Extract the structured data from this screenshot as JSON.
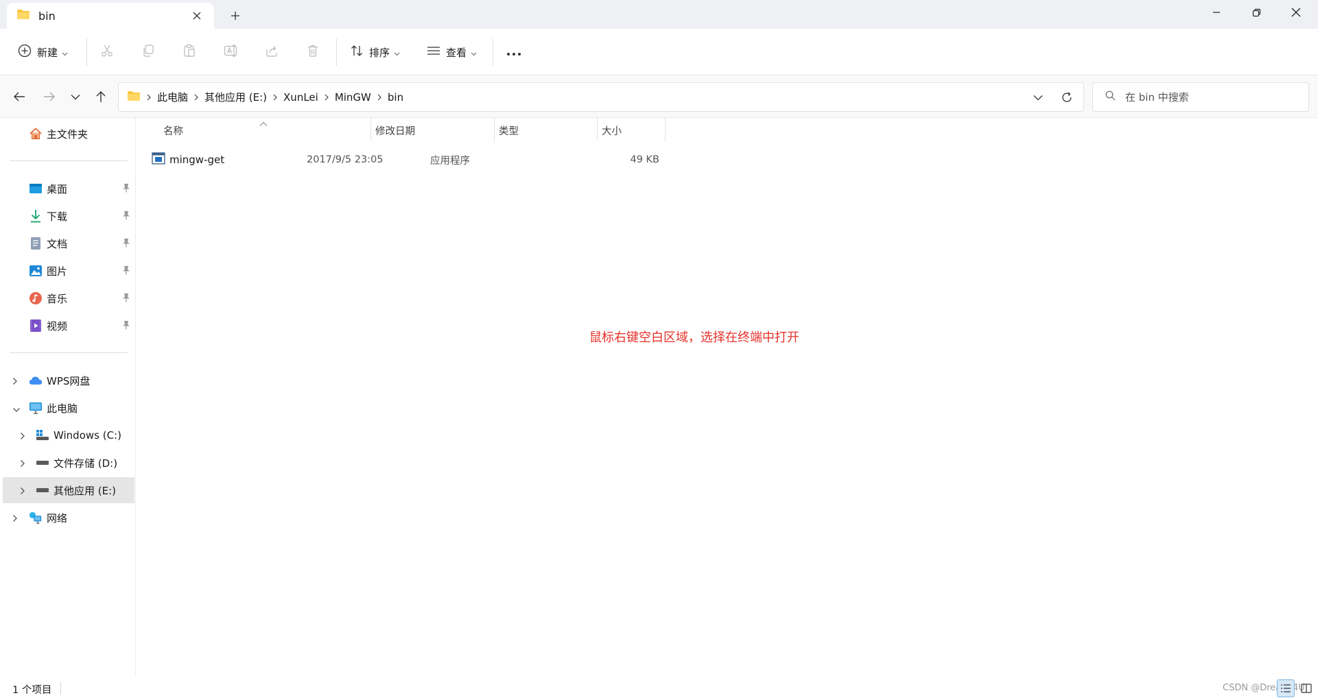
{
  "tab": {
    "title": "bin"
  },
  "toolbar": {
    "new_label": "新建",
    "sort_label": "排序",
    "view_label": "查看"
  },
  "breadcrumb": [
    "此电脑",
    "其他应用 (E:)",
    "XunLei",
    "MinGW",
    "bin"
  ],
  "search": {
    "placeholder": "在 bin 中搜索"
  },
  "sidebar": {
    "home": "主文件夹",
    "quick_access": [
      {
        "label": "桌面",
        "icon": "desktop-icon"
      },
      {
        "label": "下载",
        "icon": "download-icon"
      },
      {
        "label": "文档",
        "icon": "documents-icon"
      },
      {
        "label": "图片",
        "icon": "pictures-icon"
      },
      {
        "label": "音乐",
        "icon": "music-icon"
      },
      {
        "label": "视频",
        "icon": "videos-icon"
      }
    ],
    "wps": "WPS网盘",
    "this_pc": "此电脑",
    "drives": [
      {
        "label": "Windows (C:)"
      },
      {
        "label": "文件存储 (D:)"
      },
      {
        "label": "其他应用 (E:)"
      }
    ],
    "network": "网络"
  },
  "columns": {
    "name": "名称",
    "date": "修改日期",
    "type": "类型",
    "size": "大小"
  },
  "files": [
    {
      "name": "mingw-get",
      "date": "2017/9/5 23:05",
      "type": "应用程序",
      "size": "49 KB"
    }
  ],
  "annotation": "鼠标右键空白区域，选择在终端中打开",
  "status": {
    "count": "1 个项目",
    "watermark": "CSDN @Dream 4U"
  },
  "colors": {
    "annotation": "#e4322b",
    "folder": "#f8c640",
    "accent": "#0067c0",
    "selection": "#e5e5e5"
  }
}
